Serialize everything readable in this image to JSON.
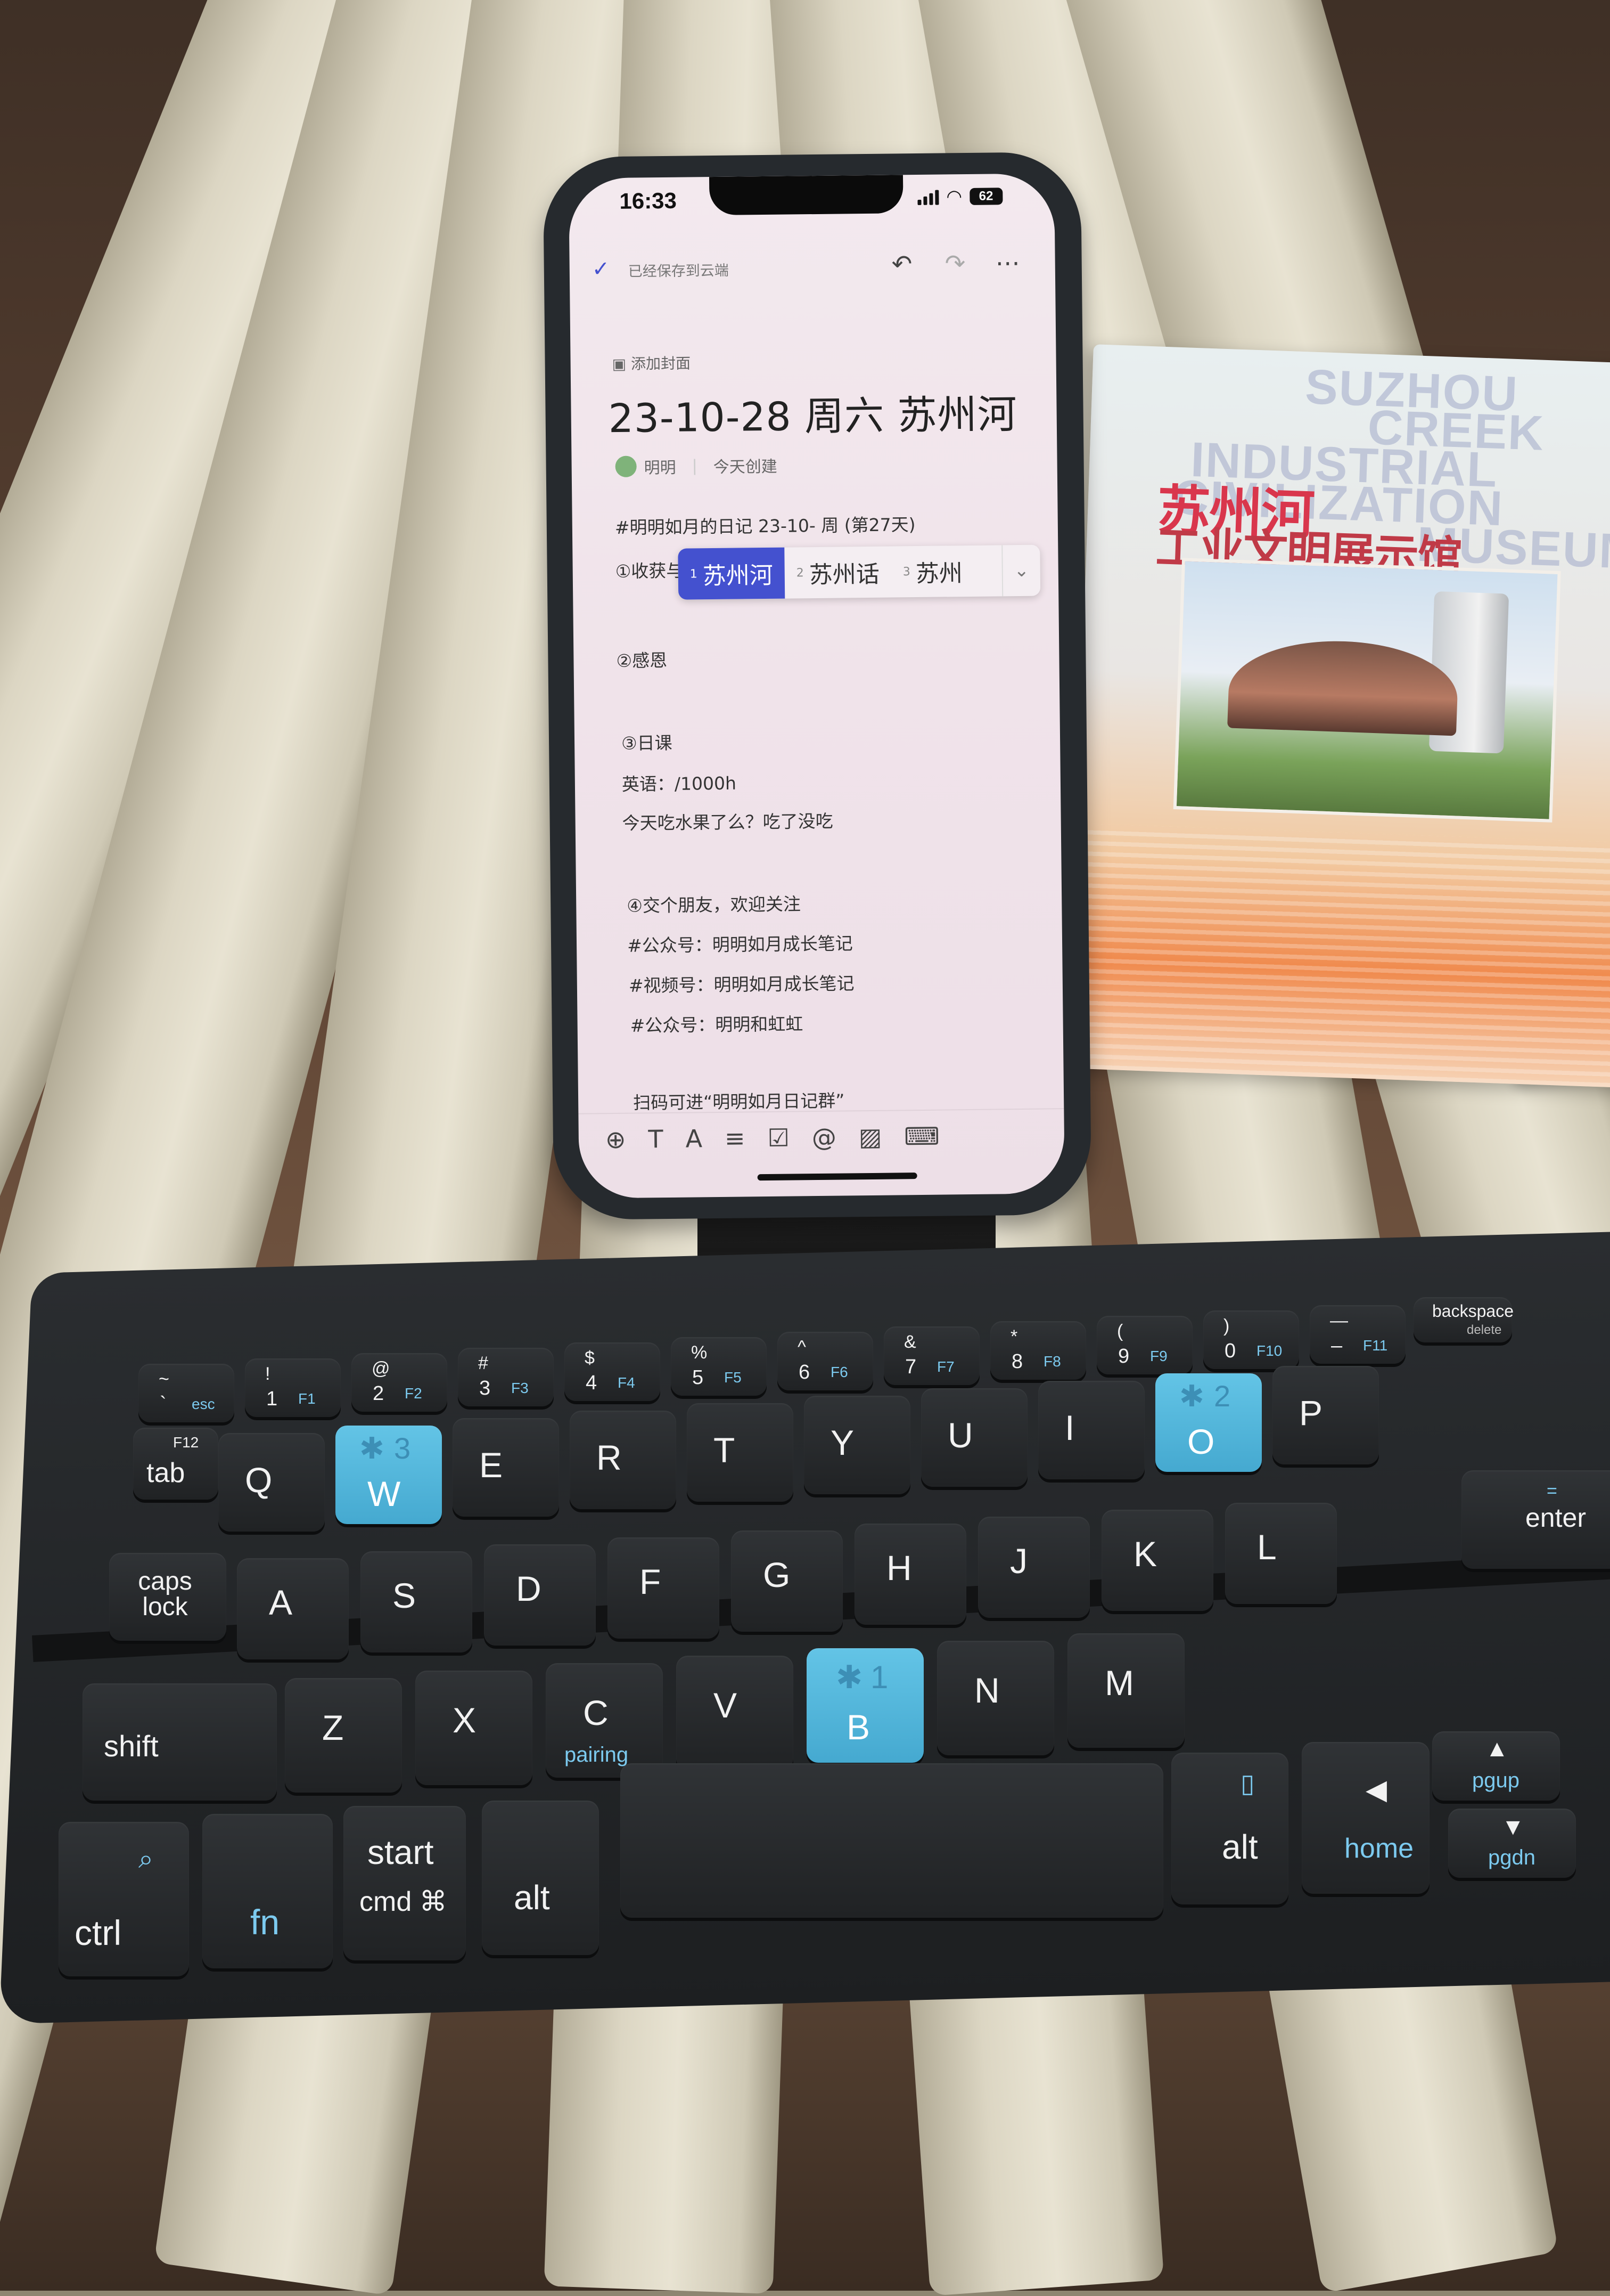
{
  "phone": {
    "status_bar": {
      "time": "16:33",
      "battery": "62"
    },
    "top_bar": {
      "saved_text": "已经保存到云端"
    },
    "add_cover": "添加封面",
    "title": "23-10-28 周六 苏州河",
    "author": "明明",
    "created": "今天创建",
    "lines": [
      "#明明如月的日记 23-10- 周 (第27天)",
      "①收获与分享【su vb h】",
      "②感恩",
      "③日课",
      "英语：/1000h",
      "今天吃水果了么？吃了没吃",
      "④交个朋友，欢迎关注",
      "#公众号：明明如月成长笔记",
      "#视频号：明明如月成长笔记",
      "#公众号：明明和虹虹",
      "扫码可进“明明如月日记群”"
    ],
    "ime_candidates": [
      {
        "n": "1",
        "text": "苏州河"
      },
      {
        "n": "2",
        "text": "苏州话"
      },
      {
        "n": "3",
        "text": "苏州"
      }
    ]
  },
  "brochure": {
    "en_lines": [
      "SUZHOU",
      "CREEK",
      "INDUSTRIAL",
      "CIVILIZATION",
      "MUSEUM"
    ],
    "zh_line1": "苏州河",
    "zh_line2": "工业文明展示馆"
  },
  "keyboard": {
    "row_num": [
      {
        "top": "~",
        "bottom": "`",
        "fn": "esc"
      },
      {
        "top": "!",
        "bottom": "1",
        "fn": "F1"
      },
      {
        "top": "@",
        "bottom": "2",
        "fn": "F2"
      },
      {
        "top": "#",
        "bottom": "3",
        "fn": "F3"
      },
      {
        "top": "$",
        "bottom": "4",
        "fn": "F4"
      },
      {
        "top": "%",
        "bottom": "5",
        "fn": "F5"
      },
      {
        "top": "^",
        "bottom": "6",
        "fn": "F6"
      },
      {
        "top": "&",
        "bottom": "7",
        "fn": "F7"
      },
      {
        "top": "*",
        "bottom": "8",
        "fn": "F8"
      },
      {
        "top": "(",
        "bottom": "9",
        "fn": "F9"
      },
      {
        "top": ")",
        "bottom": "0",
        "fn": "F10"
      },
      {
        "top": "—",
        "bottom": "–",
        "fn": "F11"
      }
    ],
    "backspace": "backspace",
    "delete": "delete",
    "tab": "tab",
    "tab_fn": "F12",
    "row_q": [
      "Q",
      "W",
      "E",
      "R",
      "T",
      "Y",
      "U",
      "I",
      "O",
      "P"
    ],
    "w_bt": "3",
    "o_bt": "2",
    "b_bt": "1",
    "caps": "caps lock",
    "row_a": [
      "A",
      "S",
      "D",
      "F",
      "G",
      "H",
      "J",
      "K",
      "L"
    ],
    "enter": "enter",
    "shift": "shift",
    "row_z": [
      "Z",
      "X",
      "C",
      "V",
      "B",
      "N",
      "M"
    ],
    "pairing": "pairing",
    "ctrl": "ctrl",
    "fn": "fn",
    "start": "start",
    "cmd": "cmd ⌘",
    "alt": "alt",
    "home": "home",
    "pgup": "pgup",
    "pgdn": "pgdn"
  }
}
